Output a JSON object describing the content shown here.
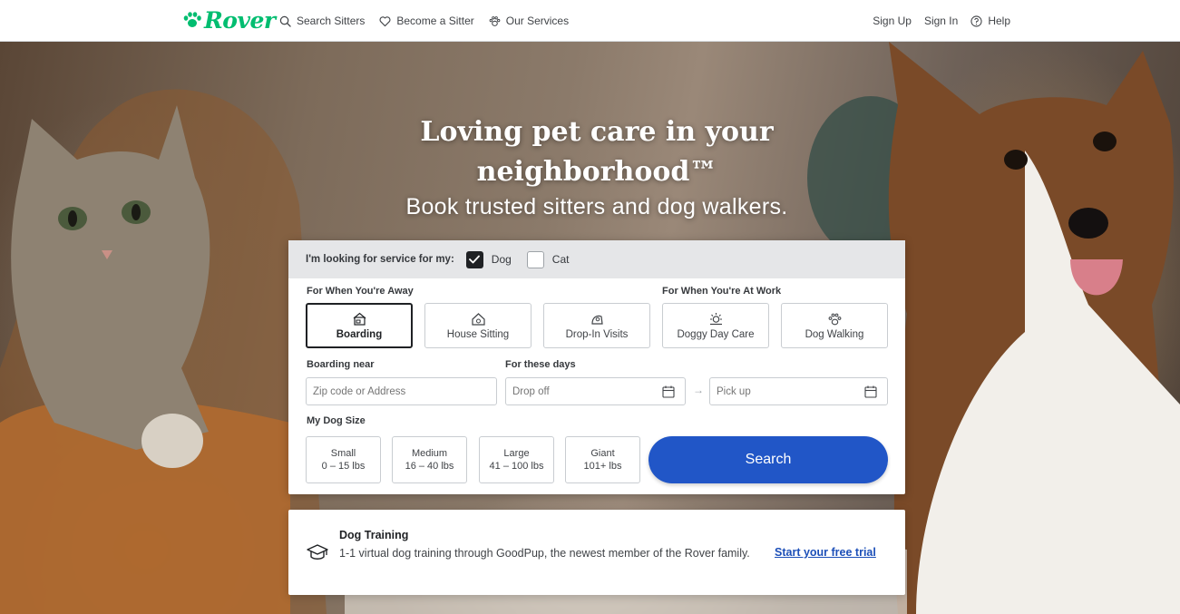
{
  "header": {
    "logo_text": "Rover",
    "nav_left": [
      {
        "label": "Search Sitters",
        "icon": "search-icon"
      },
      {
        "label": "Become a Sitter",
        "icon": "heart-icon"
      },
      {
        "label": "Our Services",
        "icon": "paw-icon"
      }
    ],
    "nav_right": [
      {
        "label": "Sign Up"
      },
      {
        "label": "Sign In"
      },
      {
        "label": "Help",
        "icon": "help-icon"
      }
    ]
  },
  "hero": {
    "headline": "Loving pet care in your neighborhood™",
    "subhead": "Book trusted sitters and dog walkers."
  },
  "search": {
    "pet_question": "I'm looking for service for my:",
    "pets": [
      {
        "label": "Dog",
        "checked": true
      },
      {
        "label": "Cat",
        "checked": false
      }
    ],
    "away_label": "For When You're Away",
    "work_label": "For When You're At Work",
    "services": [
      {
        "label": "Boarding",
        "icon": "boarding-icon",
        "selected": true
      },
      {
        "label": "House Sitting",
        "icon": "house-sitting-icon",
        "selected": false
      },
      {
        "label": "Drop-In Visits",
        "icon": "drop-in-icon",
        "selected": false
      },
      {
        "label": "Doggy Day Care",
        "icon": "day-care-icon",
        "selected": false
      },
      {
        "label": "Dog Walking",
        "icon": "dog-walking-icon",
        "selected": false
      }
    ],
    "location_label": "Boarding near",
    "location_placeholder": "Zip code or Address",
    "dates_label": "For these days",
    "dropoff_placeholder": "Drop off",
    "pickup_placeholder": "Pick up",
    "size_label": "My Dog Size",
    "sizes": [
      {
        "name": "Small",
        "range": "0 – 15 lbs"
      },
      {
        "name": "Medium",
        "range": "16 – 40 lbs"
      },
      {
        "name": "Large",
        "range": "41 – 100 lbs"
      },
      {
        "name": "Giant",
        "range": "101+ lbs"
      }
    ],
    "search_button": "Search",
    "accent_color": "#2156c7"
  },
  "promo": {
    "title": "Dog Training",
    "text": "1-1 virtual dog training through GoodPup, the newest member of the Rover family.",
    "link": "Start your free trial",
    "icon": "graduation-cap-icon"
  },
  "brand_color": "#00bd70"
}
